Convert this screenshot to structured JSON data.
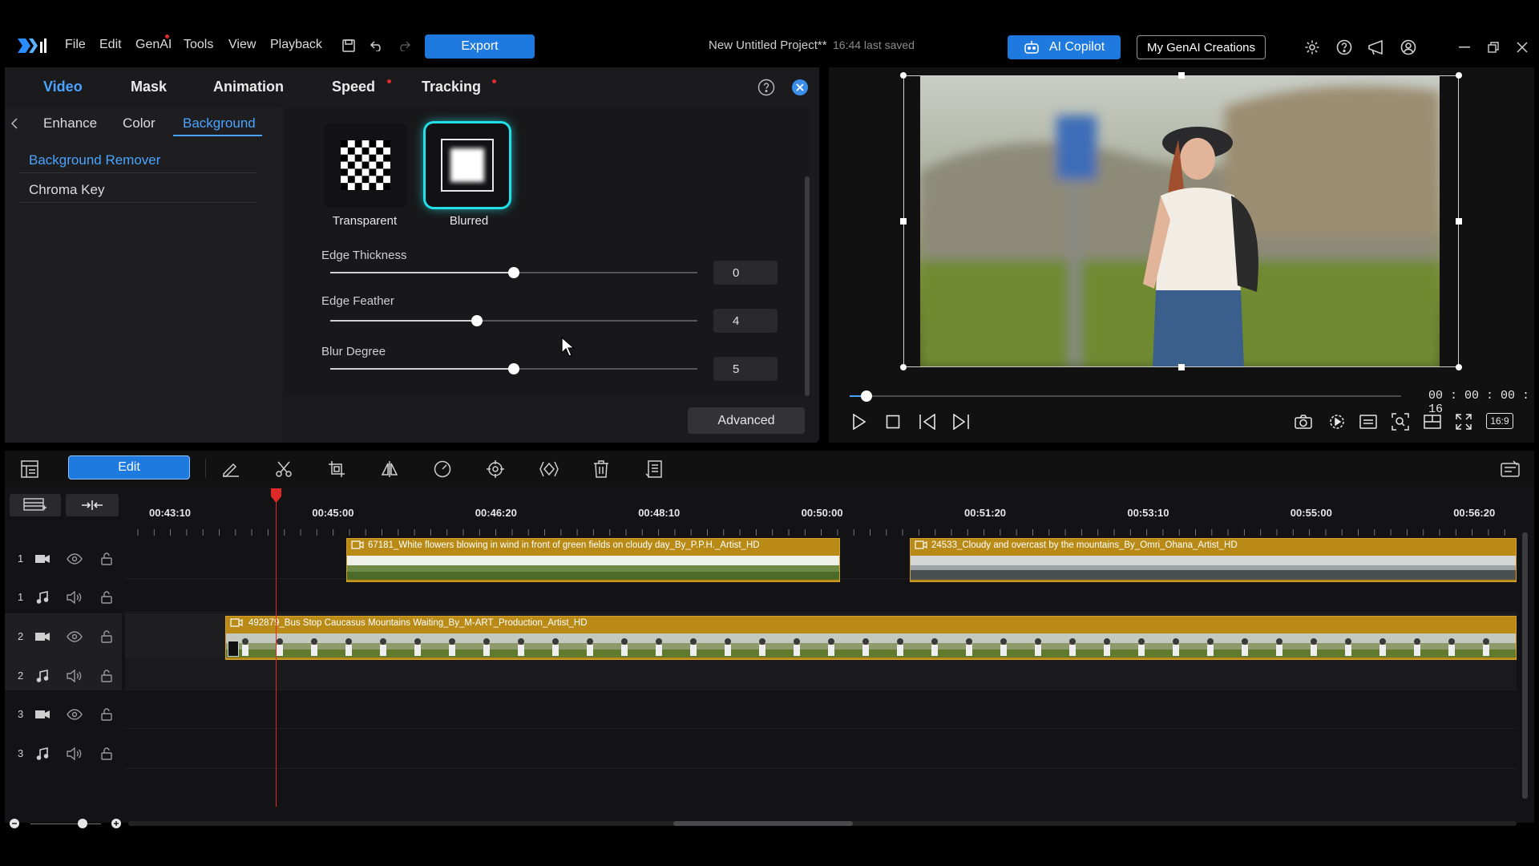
{
  "menu": {
    "items": [
      "File",
      "Edit",
      "GenAI",
      "Tools",
      "View",
      "Playback"
    ],
    "export_label": "Export",
    "project_title": "New Untitled Project**",
    "last_saved": "16:44 last saved",
    "ai_copilot_label": "AI Copilot",
    "my_genai_label": "My GenAI Creations"
  },
  "panel": {
    "tabs": [
      "Video",
      "Mask",
      "Animation",
      "Speed",
      "Tracking"
    ],
    "subtabs": [
      "Enhance",
      "Color",
      "Background"
    ],
    "list": [
      "Background Remover",
      "Chroma Key"
    ],
    "options": [
      "Transparent",
      "Blurred"
    ],
    "sliders": [
      {
        "label": "Edge Thickness",
        "value": "0",
        "fraction": 0.5
      },
      {
        "label": "Edge Feather",
        "value": "4",
        "fraction": 0.4
      },
      {
        "label": "Blur Degree",
        "value": "5",
        "fraction": 0.5
      }
    ],
    "advanced_label": "Advanced"
  },
  "preview": {
    "timecode": "00 : 00 : 00 : 16",
    "aspect_label": "16:9",
    "scrub_fraction": 0.03
  },
  "timeline": {
    "edit_label": "Edit",
    "ruler": [
      "00:43:10",
      "00:45:00",
      "00:46:20",
      "00:48:10",
      "00:50:00",
      "00:51:20",
      "00:53:10",
      "00:55:00",
      "00:56:20"
    ],
    "tracks": [
      {
        "num": "1",
        "kind": "video"
      },
      {
        "num": "1",
        "kind": "audio"
      },
      {
        "num": "2",
        "kind": "video"
      },
      {
        "num": "2",
        "kind": "audio"
      },
      {
        "num": "3",
        "kind": "video"
      },
      {
        "num": "3",
        "kind": "audio"
      }
    ],
    "clips": [
      "67181_White flowers blowing in wind in front of green fields on cloudy day_By_P.P.H._Artist_HD",
      "24533_Cloudy and overcast by the mountains_By_Omri_Ohana_Artist_HD",
      "492879_Bus Stop Caucasus Mountains Waiting_By_M-ART_Production_Artist_HD"
    ]
  },
  "colors": {
    "accent": "#1f7ae0",
    "clip": "#b98a16",
    "playhead": "#e02a2a",
    "selected_glow": "#22e0e8"
  }
}
